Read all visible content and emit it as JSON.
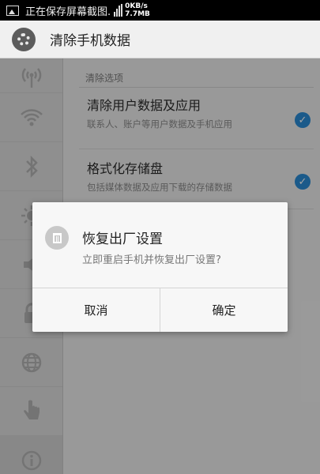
{
  "status_bar": {
    "text": "正在保存屏幕截图.",
    "speed_up": "0KB/s",
    "speed_down": "7.7MB"
  },
  "action_bar": {
    "title": "清除手机数据",
    "icon": "gear-icon"
  },
  "sidebar": {
    "items": [
      {
        "icon": "wireless-antenna-icon"
      },
      {
        "icon": "wifi-icon"
      },
      {
        "icon": "bluetooth-icon"
      },
      {
        "icon": "brightness-icon"
      },
      {
        "icon": "volume-icon"
      },
      {
        "icon": "lock-icon"
      },
      {
        "icon": "globe-icon"
      },
      {
        "icon": "touch-hand-icon"
      },
      {
        "icon": "info-icon"
      }
    ]
  },
  "main": {
    "section_header": "清除选项",
    "options": [
      {
        "title": "清除用户数据及应用",
        "desc": "联系人、账户等用户数据及手机应用",
        "checked": true
      },
      {
        "title": "格式化存储盘",
        "desc": "包括媒体数据及应用下载的存储数据",
        "checked": true
      }
    ]
  },
  "dialog": {
    "icon": "trash-icon",
    "title": "恢复出厂设置",
    "message": "立即重启手机并恢复出厂设置?",
    "cancel_label": "取消",
    "confirm_label": "确定"
  },
  "colors": {
    "accent": "#2a8bd4",
    "status_bar": "#000000"
  }
}
